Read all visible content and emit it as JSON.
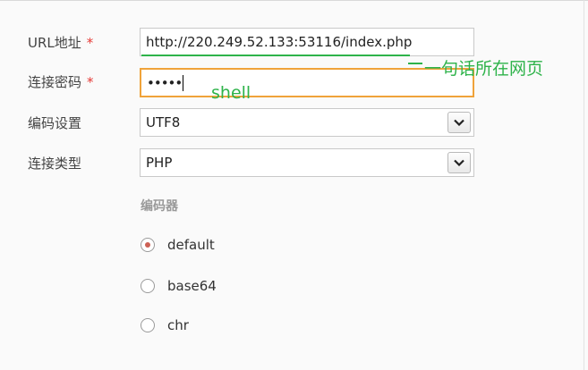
{
  "form": {
    "url": {
      "label": "URL地址",
      "required": "*",
      "value": "http://220.249.52.133:53116/index.php"
    },
    "password": {
      "label": "连接密码",
      "required": "*",
      "masked_value": "•••••"
    },
    "encoding": {
      "label": "编码设置",
      "selected": "UTF8"
    },
    "conn_type": {
      "label": "连接类型",
      "selected": "PHP"
    },
    "encoder": {
      "title": "编码器",
      "options": [
        {
          "label": "default",
          "checked": true
        },
        {
          "label": "base64",
          "checked": false
        },
        {
          "label": "chr",
          "checked": false
        }
      ]
    }
  },
  "annotations": {
    "url_note": "一句话所在网页",
    "password_note": "shell",
    "color": "#2eb34a"
  },
  "colors": {
    "required": "#e53935",
    "focus_border": "#f0a33a"
  }
}
